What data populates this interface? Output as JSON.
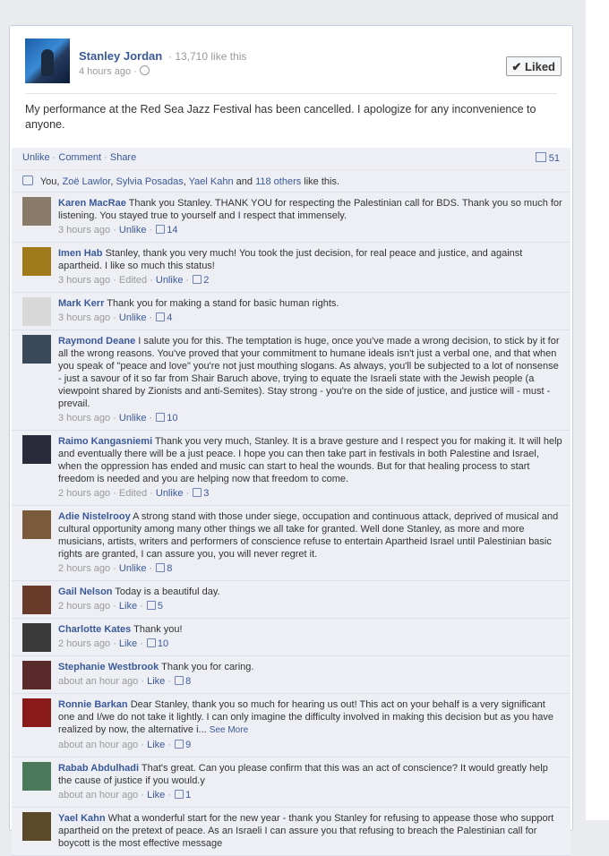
{
  "post": {
    "page_name": "Stanley Jordan",
    "like_count": "· 13,710 like this",
    "time": "4 hours ago ·",
    "liked_button": "✔ Liked",
    "status": "My performance at the Red Sea Jazz Festival has been cancelled. I apologize for any inconvenience to anyone."
  },
  "actions": {
    "unlike": "Unlike",
    "comment": "Comment",
    "share": "Share",
    "comment_count": "51"
  },
  "likers": {
    "you": "You,",
    "names": [
      "Zoë Lawlor",
      "Sylvia Posadas",
      "Yael Kahn"
    ],
    "and": "and",
    "others": "118 others",
    "suffix": "like this."
  },
  "comments": [
    {
      "author": "Karen MacRae",
      "text": "Thank you Stanley. THANK YOU for respecting the Palestinian call for BDS. Thank you so much for listening. You stayed true to yourself and I respect that immensely.",
      "time": "3 hours ago",
      "action": "Unlike",
      "likes": "14",
      "edited": "",
      "avatar_color": "#8a7a6a"
    },
    {
      "author": "Imen Hab",
      "text": "Stanley, thank you very much! You took the just decision, for real peace and justice, and against apartheid. I like so much this status!",
      "time": "3 hours ago",
      "action": "Unlike",
      "likes": "2",
      "edited": "Edited",
      "avatar_color": "#a07a1a"
    },
    {
      "author": "Mark Kerr",
      "text": "Thank you for making a stand for basic human rights.",
      "time": "3 hours ago",
      "action": "Unlike",
      "likes": "4",
      "edited": "",
      "avatar_color": "#d8d8d8"
    },
    {
      "author": "Raymond Deane",
      "text": "I salute you for this. The temptation is huge, once you've made a wrong decision, to stick by it for all the wrong reasons. You've proved that your commitment to humane ideals isn't just a verbal one, and that when you speak of \"peace and love\" you're not just mouthing slogans. As always, you'll be subjected to a lot of nonsense - just a savour of it so far from Shair Baruch above, trying to equate the Israeli state with the Jewish people (a viewpoint shared by Zionists and anti-Semites). Stay strong - you're on the side of justice, and justice will - must - prevail.",
      "time": "3 hours ago",
      "action": "Unlike",
      "likes": "10",
      "edited": "",
      "avatar_color": "#3a4a5a"
    },
    {
      "author": "Raimo Kangasniemi",
      "text": "Thank you very much, Stanley. It is a brave gesture and I respect you for making it. It will help and eventually there will be a just peace. I hope you can then take part in festivals in both Palestine and Israel, when the oppression has ended and music can start to heal the wounds. But for that healing process to start freedom is needed and you are helping now that freedom to come.",
      "time": "2 hours ago",
      "action": "Unlike",
      "likes": "3",
      "edited": "Edited",
      "avatar_color": "#2a2a3a"
    },
    {
      "author": "Adie Nistelrooy",
      "text": "A strong stand with those under siege, occupation and continuous attack, deprived of musical and cultural opportunity among many other things we all take for granted. Well done Stanley, as more and more musicians, artists, writers and performers of conscience refuse to entertain Apartheid Israel until Palestinian basic rights are granted, I can assure you, you will never regret it.",
      "time": "2 hours ago",
      "action": "Unlike",
      "likes": "8",
      "edited": "",
      "avatar_color": "#7a5a3a"
    },
    {
      "author": "Gail Nelson",
      "text": "Today is a beautiful day.",
      "time": "2 hours ago",
      "action": "Like",
      "likes": "5",
      "edited": "",
      "avatar_color": "#6a3a2a"
    },
    {
      "author": "Charlotte Kates",
      "text": "Thank you!",
      "time": "2 hours ago",
      "action": "Like",
      "likes": "10",
      "edited": "",
      "avatar_color": "#3a3a3a"
    },
    {
      "author": "Stephanie Westbrook",
      "text": "Thank you for caring.",
      "time": "about an hour ago",
      "action": "Like",
      "likes": "8",
      "edited": "",
      "avatar_color": "#5a2a2a"
    },
    {
      "author": "Ronnie Barkan",
      "text": "Dear Stanley, thank you so much for hearing us out! This act on your behalf is a very significant one and I/we do not take it lightly. I can only imagine the difficulty involved in making this decision but as you have realized by now, the alternative i...",
      "see_more": "See More",
      "time": "about an hour ago",
      "action": "Like",
      "likes": "9",
      "edited": "",
      "avatar_color": "#8a1a1a"
    },
    {
      "author": "Rabab Abdulhadi",
      "text": "That's great. Can you please confirm that this was an act of conscience? It would greatly help the cause of justice if you would.y",
      "time": "about an hour ago",
      "action": "Like",
      "likes": "1",
      "edited": "",
      "avatar_color": "#4a7a5a"
    },
    {
      "author": "Yael Kahn",
      "text": "What a wonderful start for the new year - thank you Stanley for refusing to appease those who support apartheid on the pretext of peace. As an Israeli I can assure you that refusing to breach the Palestinian call for boycott is the most effective message",
      "time": "",
      "action": "",
      "likes": "",
      "edited": "",
      "avatar_color": "#5a4a2a"
    }
  ]
}
